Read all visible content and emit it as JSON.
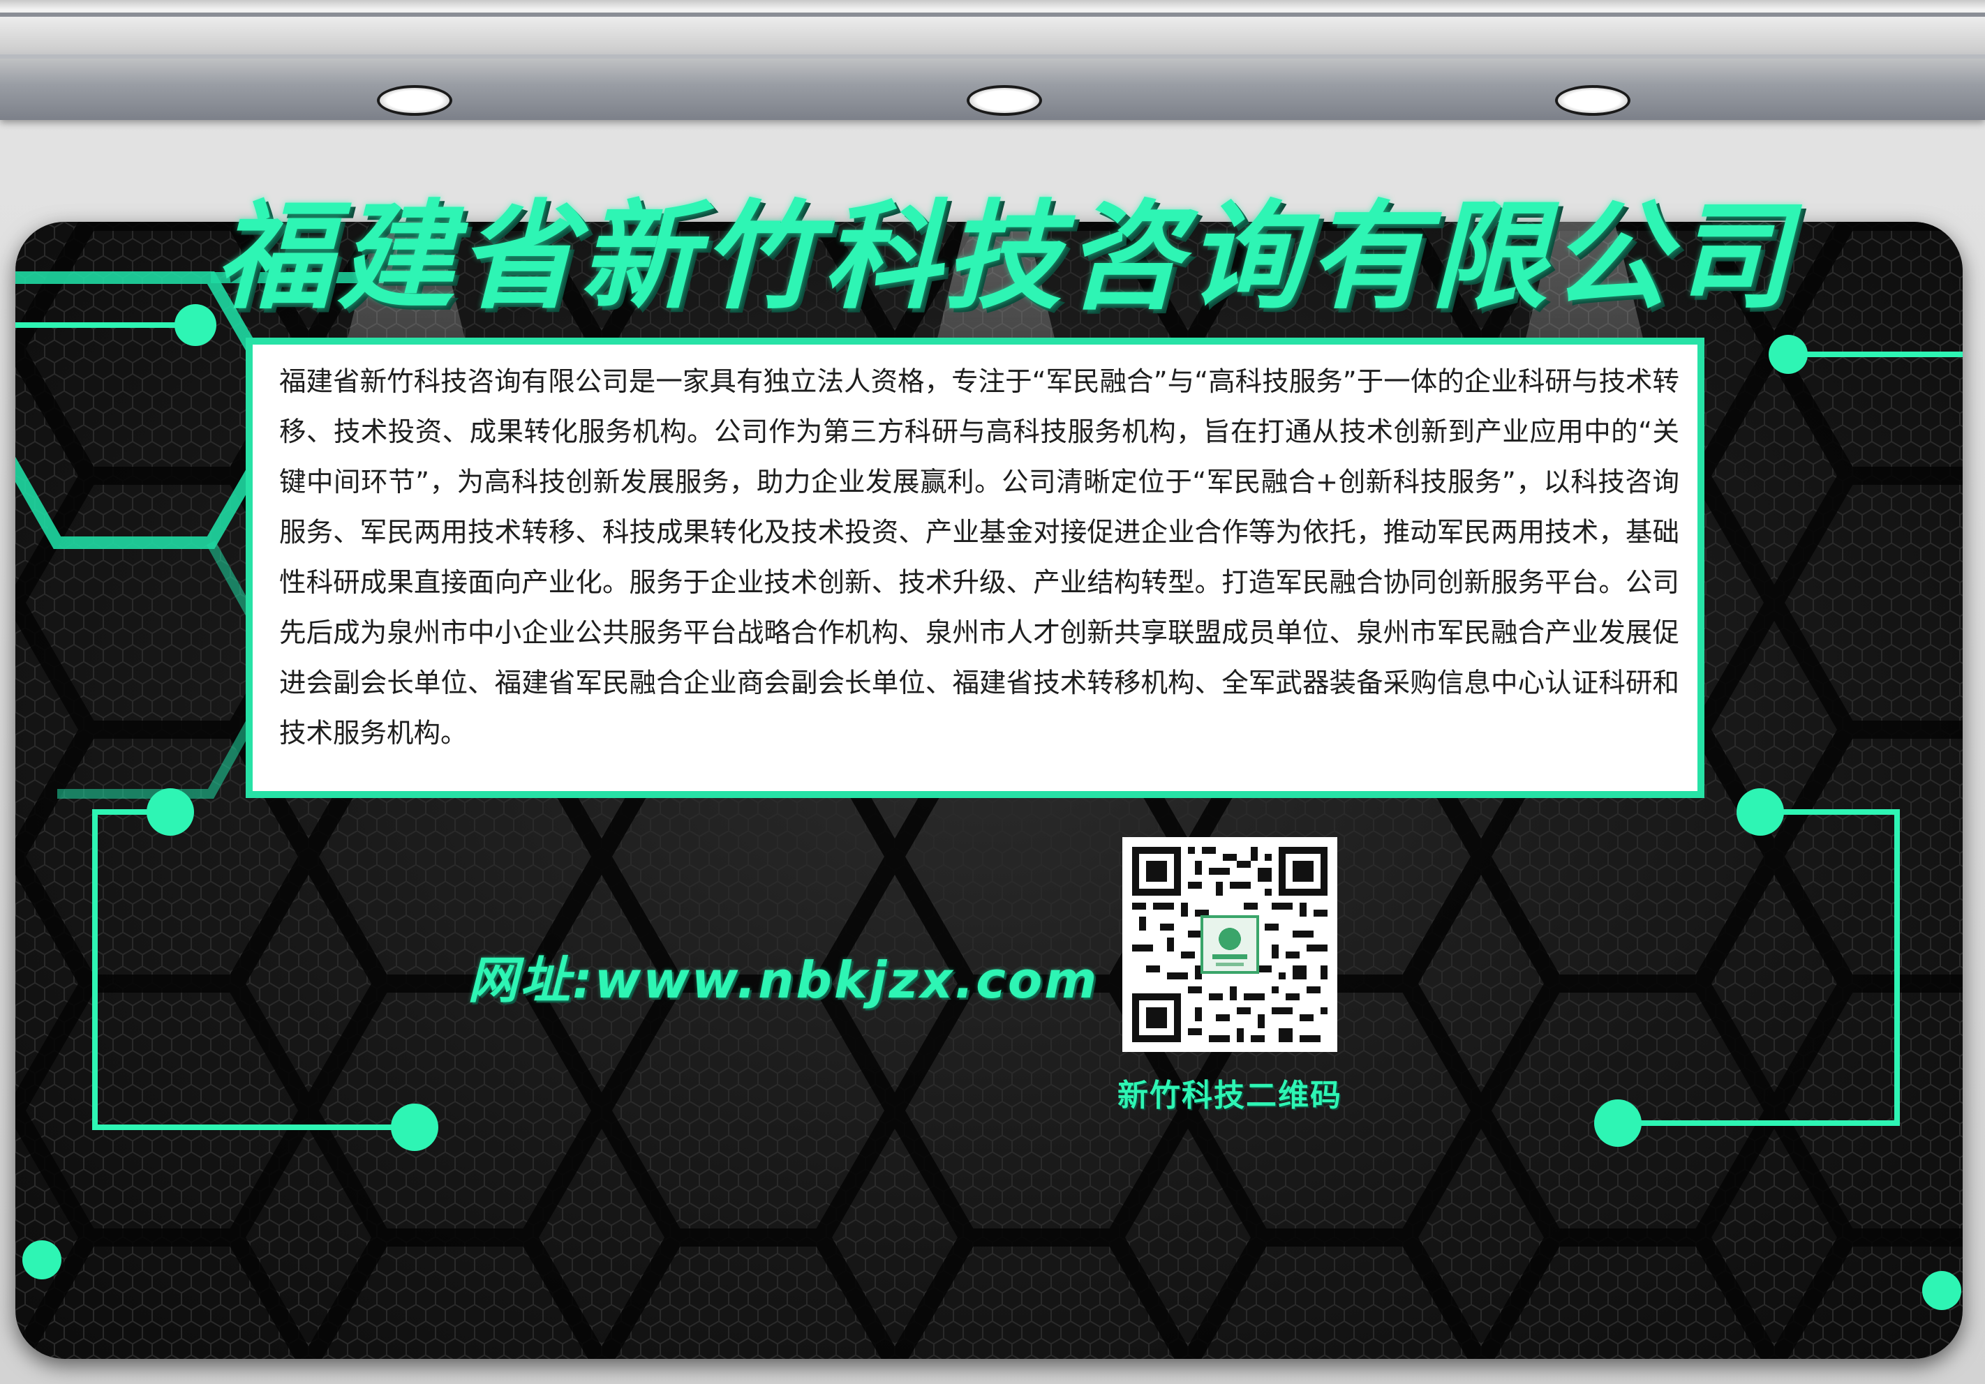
{
  "company": {
    "title": "福建省新竹科技咨询有限公司",
    "description": "福建省新竹科技咨询有限公司是一家具有独立法人资格，专注于“军民融合”与“高科技服务”于一体的企业科研与技术转移、技术投资、成果转化服务机构。公司作为第三方科研与高科技服务机构，旨在打通从技术创新到产业应用中的“关键中间环节”，为高科技创新发展服务，助力企业发展赢利。公司清晰定位于“军民融合+创新科技服务”，以科技咨询服务、军民两用技术转移、科技成果转化及技术投资、产业基金对接促进企业合作等为依托，推动军民两用技术，基础性科研成果直接面向产业化。服务于企业技术创新、技术升级、产业结构转型。打造军民融合协同创新服务平台。公司先后成为泉州市中小企业公共服务平台战略合作机构、泉州市人才创新共享联盟成员单位、泉州市军民融合产业发展促进会副会长单位、福建省军民融合企业商会副会长单位、福建省技术转移机构、全军武器装备采购信息中心认证科研和技术服务机构。"
  },
  "footer": {
    "url_text": "网址:www.nbkjzx.com",
    "qr_label": "新竹科技二维码"
  },
  "colors": {
    "accent": "#2ef5b4",
    "board_background": "#161616",
    "box_border": "#27e2a6"
  },
  "icons": {
    "qr": "qr-code",
    "spotlight": "spotlight-lamp"
  }
}
